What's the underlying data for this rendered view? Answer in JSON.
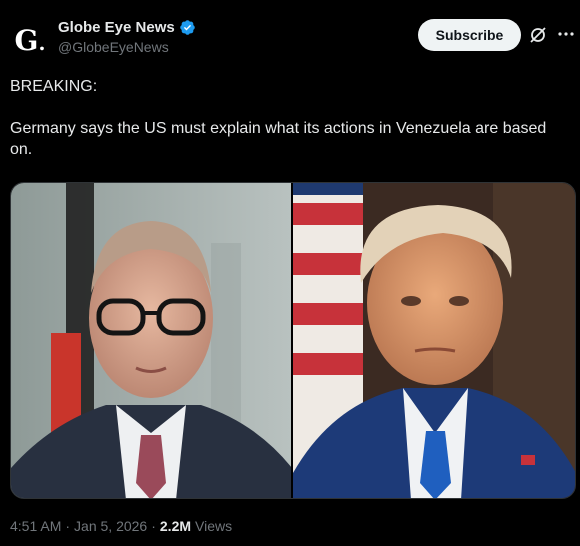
{
  "account": {
    "display_name": "Globe Eye News",
    "handle": "@GlobeEyeNews",
    "avatar_letter": "G",
    "verified_color": "#1d9bf0"
  },
  "actions": {
    "subscribe_label": "Subscribe",
    "grok_icon": "grok-icon",
    "more_icon": "more-icon"
  },
  "post": {
    "text": "BREAKING:\n\nGermany says the US must explain what its actions in Venezuela are based on."
  },
  "media": {
    "left_photo": "Man with glasses in suit before German flag",
    "right_photo": "Man in navy suit with blue tie before US flag"
  },
  "meta": {
    "time": "4:51 AM",
    "date": "Jan 5, 2026",
    "views_count": "2.2M",
    "views_label": "Views",
    "separator": "·"
  }
}
